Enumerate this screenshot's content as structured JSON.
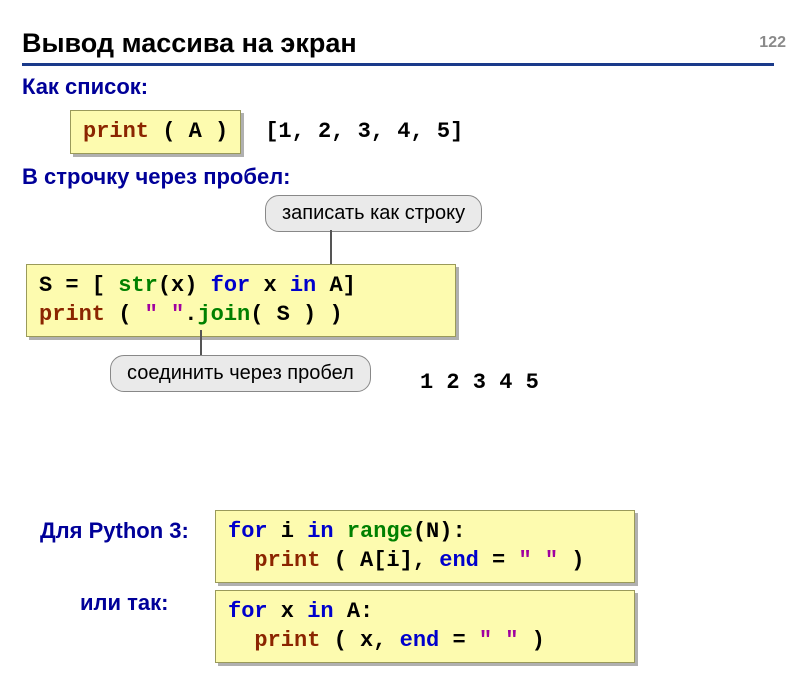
{
  "page_number": "122",
  "title": "Вывод массива на экран",
  "section1": {
    "label": "Как список:",
    "code": {
      "fn": "print",
      "open": " ( ",
      "arg": "A",
      "close": " )"
    },
    "output": "[1, 2, 3, 4, 5]"
  },
  "section2": {
    "label": "В строчку через пробел:",
    "callout_top": "записать как строку",
    "code": {
      "line1": {
        "s": "S",
        "eq": " = [ ",
        "str": "str",
        "p1": "(x) ",
        "for": "for",
        "sp1": " x ",
        "in": "in",
        "a": " A]"
      },
      "line2": {
        "print": "print",
        "p2": " ( ",
        "q1": "\" \"",
        "dot": ".",
        "join": "join",
        "p3": "( S ) )"
      }
    },
    "callout_bottom": "соединить через пробел",
    "output": "1 2 3 4 5"
  },
  "section3": {
    "label": "Для Python 3:",
    "code1": {
      "line1": {
        "for": "for",
        "i": " i ",
        "in": "in",
        "sp": " ",
        "range": "range",
        "n": "(N):"
      },
      "line2": {
        "pad": "  ",
        "print": "print",
        "p": " ( A[i], ",
        "end": "end",
        "eq": " = ",
        "q": "\" \"",
        "cl": " )"
      }
    },
    "label_or": "или так:",
    "code2": {
      "line1": {
        "for": "for",
        "x": " x ",
        "in": "in",
        "a": " A:"
      },
      "line2": {
        "pad": "  ",
        "print": "print",
        "p": " ( x, ",
        "end": "end",
        "eq": " = ",
        "q": "\" \"",
        "cl": " )"
      }
    }
  }
}
